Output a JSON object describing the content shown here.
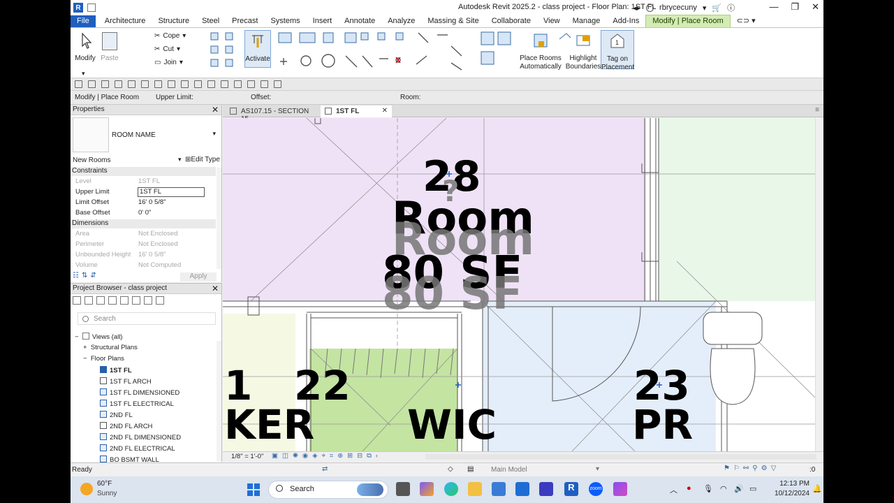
{
  "titlebar": {
    "app_title": "Autodesk Revit 2025.2 - class project - Floor Plan: 1ST FL",
    "username": "rbrycecuny"
  },
  "tabs": [
    "File",
    "Architecture",
    "Structure",
    "Steel",
    "Precast",
    "Systems",
    "Insert",
    "Annotate",
    "Analyze",
    "Massing & Site",
    "Collaborate",
    "View",
    "Manage",
    "Add-Ins",
    "Modify | Place Room"
  ],
  "ribbon": {
    "modify": "Modify",
    "paste": "Paste",
    "cope": "Cope",
    "cut": "Cut",
    "join": "Join",
    "activate": "Activate",
    "place_rooms_1": "Place Rooms",
    "place_rooms_2": "Automatically",
    "highlight_1": "Highlight",
    "highlight_2": "Boundaries",
    "tag_1": "Tag on",
    "tag_2": "Placement"
  },
  "options_bar": {
    "context": "Modify | Place Room",
    "upper_limit": "Upper Limit:",
    "offset": "Offset:",
    "room": "Room:"
  },
  "properties": {
    "title": "Properties",
    "type_name": "ROOM NAME",
    "instance_filter": "New Rooms",
    "edit_type": "Edit Type",
    "sections": {
      "constraints": "Constraints",
      "dimensions": "Dimensions"
    },
    "rows": [
      {
        "k": "Level",
        "v": "1ST FL"
      },
      {
        "k": "Upper Limit",
        "v": "1ST FL"
      },
      {
        "k": "Limit Offset",
        "v": "16'  0 5/8\""
      },
      {
        "k": "Base Offset",
        "v": "0'  0\""
      },
      {
        "k": "Area",
        "v": "Not Enclosed"
      },
      {
        "k": "Perimeter",
        "v": "Not Enclosed"
      },
      {
        "k": "Unbounded Height",
        "v": "16'  0 5/8\""
      },
      {
        "k": "Volume",
        "v": "Not Computed"
      }
    ],
    "apply": "Apply"
  },
  "browser": {
    "title": "Project Browser - class project",
    "search_placeholder": "Search",
    "views_all": "Views (all)",
    "structural_plans": "Structural Plans",
    "floor_plans": "Floor Plans",
    "items": [
      "1ST FL",
      "1ST FL ARCH",
      "1ST FL DIMENSIONED",
      "1ST FL ELECTRICAL",
      "2ND FL",
      "2ND FL ARCH",
      "2ND FL DIMENSIONED",
      "2ND FL ELECTRICAL",
      "BO BSMT WALL"
    ]
  },
  "view_tabs": [
    "AS107.15 - SECTION 15",
    "1ST FL"
  ],
  "canvas": {
    "tag_top_number": "28",
    "tag_top_q": "?",
    "tag_top_name": "Room",
    "tag_top_area": "80  SF",
    "left_number": "1",
    "left_name": "KER",
    "wic_number": "22",
    "wic_name": "WIC",
    "pr_number": "23",
    "pr_name": "PR"
  },
  "view_control": {
    "scale": "1/8\" = 1'-0\""
  },
  "status": {
    "ready": "Ready",
    "model": "Main Model",
    "filter_count": ":0"
  },
  "taskbar": {
    "temp": "60°F",
    "weather": "Sunny",
    "search": "Search",
    "time": "12:13 PM",
    "date": "10/12/2024",
    "zoom": "zoom"
  },
  "colors": {
    "file_tab": "#1f5fbf",
    "context_tab": "#d4ecb4",
    "room_purple": "#efe2f6",
    "room_green": "#c4e4a2",
    "room_blue": "#e4eefa",
    "room_mint": "#e9f7e9"
  }
}
